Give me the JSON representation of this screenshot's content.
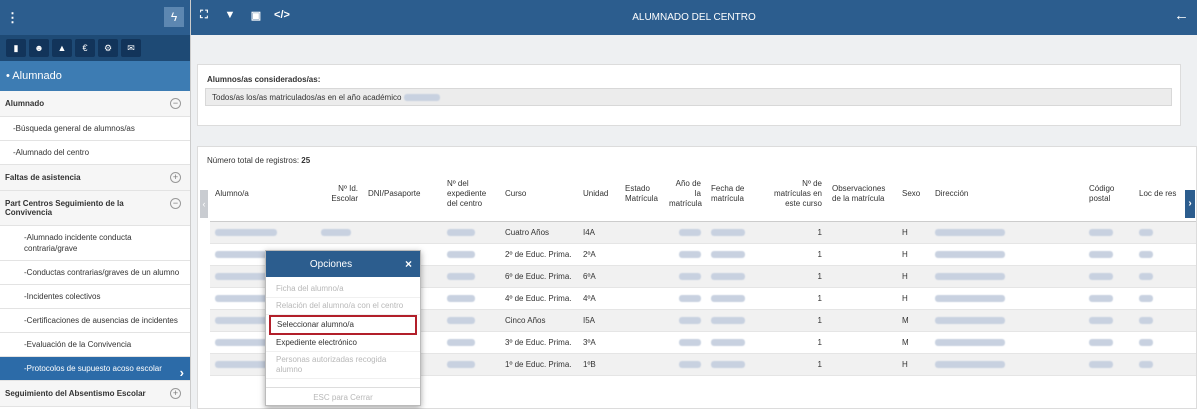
{
  "sidebar": {
    "section_title": "• Alumnado",
    "icon_names": [
      "building-icon",
      "users-icon",
      "graduation-cap-icon",
      "euro-icon",
      "gears-icon",
      "envelope-icon"
    ],
    "items": [
      {
        "label": "Alumnado",
        "kind": "grp",
        "toggle": "−"
      },
      {
        "label": "-Búsqueda general de alumnos/as",
        "kind": "sub"
      },
      {
        "label": "-Alumnado del centro",
        "kind": "sub"
      },
      {
        "label": "Faltas de asistencia",
        "kind": "grp",
        "toggle": "+"
      },
      {
        "label": "Part Centros Seguimiento de la Convivencia",
        "kind": "grp",
        "toggle": "−"
      },
      {
        "label": "-Alumnado incidente conducta contraria/grave",
        "kind": "sub2"
      },
      {
        "label": "-Conductas contrarias/graves de un alumno",
        "kind": "sub2"
      },
      {
        "label": "-Incidentes colectivos",
        "kind": "sub2"
      },
      {
        "label": "-Certificaciones de ausencias de incidentes",
        "kind": "sub2"
      },
      {
        "label": "-Evaluación de la Convivencia",
        "kind": "sub2"
      },
      {
        "label": "-Protocolos de supuesto acoso escolar",
        "kind": "sub2",
        "active": true
      },
      {
        "label": "Seguimiento del Absentismo Escolar",
        "kind": "grp",
        "toggle": "+"
      }
    ]
  },
  "topbar": {
    "title": "ALUMNADO DEL CENTRO",
    "icons": [
      "expand-icon",
      "filter-icon",
      "pdf-icon",
      "code-icon"
    ]
  },
  "filter_panel": {
    "label": "Alumnos/as considerados/as:",
    "value": "Todos/as los/as matriculados/as en el año académico"
  },
  "table": {
    "count_label": "Número total de registros:",
    "count": "25",
    "headers": [
      "Alumno/a",
      "Nº Id. Escolar",
      "DNI/Pasaporte",
      "Nº del expediente del centro",
      "Curso",
      "Unidad",
      "Estado Matrícula",
      "Año de la matrícula",
      "Fecha de matrícula",
      "Nº de matrículas en este curso",
      "Observaciones de la matrícula",
      "Sexo",
      "Dirección",
      "Código postal",
      "Loc de res"
    ],
    "rows": [
      {
        "curso": "Cuatro Años",
        "unidad": "I4A",
        "num": "1",
        "sexo": "H"
      },
      {
        "curso": "2º de Educ. Prima.",
        "unidad": "2ºA",
        "num": "1",
        "sexo": "H"
      },
      {
        "curso": "6º de Educ. Prima.",
        "unidad": "6ºA",
        "num": "1",
        "sexo": "H"
      },
      {
        "curso": "4º de Educ. Prima.",
        "unidad": "4ºA",
        "num": "1",
        "sexo": "H"
      },
      {
        "curso": "Cinco Años",
        "unidad": "I5A",
        "num": "1",
        "sexo": "M"
      },
      {
        "curso": "3º de Educ. Prima.",
        "unidad": "3ºA",
        "num": "1",
        "sexo": "M"
      },
      {
        "curso": "1º de Educ. Prima.",
        "unidad": "1ºB",
        "num": "1",
        "sexo": "H"
      }
    ]
  },
  "popup": {
    "title": "Opciones",
    "close": "×",
    "items": [
      {
        "label": "Ficha del alumno/a",
        "state": "disabled"
      },
      {
        "label": "Relación del alumno/a con el centro",
        "state": "disabled"
      },
      {
        "label": "Seleccionar alumno/a",
        "state": "selected"
      },
      {
        "label": "Expediente electrónico",
        "state": "enabled"
      },
      {
        "label": "Personas autorizadas recogida alumno",
        "state": "disabled"
      }
    ],
    "esc": "ESC para Cerrar"
  }
}
